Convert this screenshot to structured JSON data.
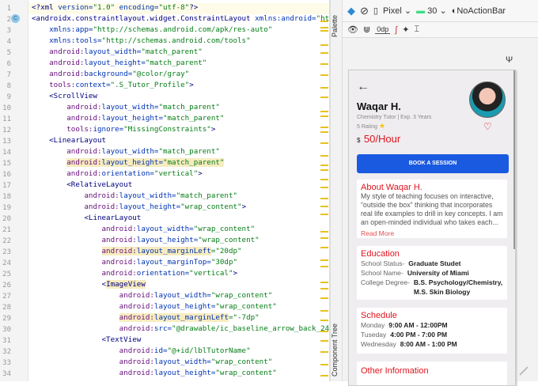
{
  "editor": {
    "lines": [
      {
        "i": 0,
        "t": [
          [
            "tag",
            "<?xml "
          ],
          [
            "attr",
            "version="
          ],
          [
            "val",
            "\"1.0\" "
          ],
          [
            "attr",
            "encoding="
          ],
          [
            "val",
            "\"utf-8\""
          ],
          [
            "tag",
            "?>"
          ]
        ],
        "cur": true
      },
      {
        "i": 0,
        "t": [
          [
            "tag",
            "<androidx.constraintlayout.widget.ConstraintLayout "
          ],
          [
            "attr",
            "xmlns:android="
          ],
          [
            "val",
            "\"ht"
          ]
        ]
      },
      {
        "i": 1,
        "t": [
          [
            "attr",
            "xmlns:app="
          ],
          [
            "val",
            "\"http://schemas.android.com/apk/res-auto\""
          ]
        ]
      },
      {
        "i": 1,
        "t": [
          [
            "attr",
            "xmlns:tools="
          ],
          [
            "val",
            "\"http://schemas.android.com/tools\""
          ]
        ]
      },
      {
        "i": 1,
        "t": [
          [
            "ns",
            "android:"
          ],
          [
            "attr",
            "layout_width="
          ],
          [
            "val",
            "\"match_parent\""
          ]
        ]
      },
      {
        "i": 1,
        "t": [
          [
            "ns",
            "android:"
          ],
          [
            "attr",
            "layout_height="
          ],
          [
            "val",
            "\"match_parent\""
          ]
        ]
      },
      {
        "i": 1,
        "t": [
          [
            "ns",
            "android:"
          ],
          [
            "attr",
            "background="
          ],
          [
            "val",
            "\"@color/gray\""
          ]
        ]
      },
      {
        "i": 1,
        "t": [
          [
            "ns",
            "tools:"
          ],
          [
            "attr",
            "context="
          ],
          [
            "val",
            "\".S_Tutor_Profile\""
          ],
          [
            "tag",
            ">"
          ]
        ]
      },
      {
        "i": 1,
        "t": [
          [
            "tag",
            "<ScrollView"
          ]
        ]
      },
      {
        "i": 2,
        "t": [
          [
            "ns",
            "android:"
          ],
          [
            "attr",
            "layout_width="
          ],
          [
            "val",
            "\"match_parent\""
          ]
        ]
      },
      {
        "i": 2,
        "t": [
          [
            "ns",
            "android:"
          ],
          [
            "attr",
            "layout_height="
          ],
          [
            "val",
            "\"match_parent\""
          ]
        ]
      },
      {
        "i": 2,
        "t": [
          [
            "ns",
            "tools:"
          ],
          [
            "attr",
            "ignore="
          ],
          [
            "val",
            "\"MissingConstraints\""
          ],
          [
            "tag",
            ">"
          ]
        ]
      },
      {
        "i": 1,
        "t": [
          [
            "tag",
            "<LinearLayout"
          ]
        ]
      },
      {
        "i": 2,
        "t": [
          [
            "ns",
            "android:"
          ],
          [
            "attr",
            "layout_width="
          ],
          [
            "val",
            "\"match_parent\""
          ]
        ]
      },
      {
        "i": 2,
        "t": [
          [
            "ns h",
            "android:"
          ],
          [
            "attr h",
            "layout_height="
          ],
          [
            "val h",
            "\"match_parent\""
          ]
        ]
      },
      {
        "i": 2,
        "t": [
          [
            "ns",
            "android:"
          ],
          [
            "attr",
            "orientation="
          ],
          [
            "val",
            "\"vertical\""
          ],
          [
            "tag",
            ">"
          ]
        ]
      },
      {
        "i": 2,
        "t": [
          [
            "tag",
            "<RelativeLayout"
          ]
        ]
      },
      {
        "i": 3,
        "t": [
          [
            "ns",
            "android:"
          ],
          [
            "attr",
            "layout_width="
          ],
          [
            "val",
            "\"match_parent\""
          ]
        ]
      },
      {
        "i": 3,
        "t": [
          [
            "ns",
            "android:"
          ],
          [
            "attr",
            "layout_height="
          ],
          [
            "val",
            "\"wrap_content\""
          ],
          [
            "tag",
            ">"
          ]
        ]
      },
      {
        "i": 3,
        "t": [
          [
            "tag",
            "<LinearLayout"
          ]
        ]
      },
      {
        "i": 4,
        "t": [
          [
            "ns",
            "android:"
          ],
          [
            "attr",
            "layout_width="
          ],
          [
            "val",
            "\"wrap_content\""
          ]
        ]
      },
      {
        "i": 4,
        "t": [
          [
            "ns",
            "android:"
          ],
          [
            "attr",
            "layout_height="
          ],
          [
            "val",
            "\"wrap_content\""
          ]
        ]
      },
      {
        "i": 4,
        "t": [
          [
            "ns h",
            "android:"
          ],
          [
            "attr h",
            "layout_marginLeft"
          ],
          [
            "val",
            "=\"20dp\""
          ]
        ]
      },
      {
        "i": 4,
        "t": [
          [
            "ns",
            "android:"
          ],
          [
            "attr",
            "layout_marginTop="
          ],
          [
            "val",
            "\"30dp\""
          ]
        ]
      },
      {
        "i": 4,
        "t": [
          [
            "ns",
            "android:"
          ],
          [
            "attr",
            "orientation="
          ],
          [
            "val",
            "\"vertical\""
          ],
          [
            "tag",
            ">"
          ]
        ]
      },
      {
        "i": 4,
        "t": [
          [
            "tag",
            "<"
          ],
          [
            "tag h",
            "ImageView"
          ]
        ]
      },
      {
        "i": 5,
        "t": [
          [
            "ns",
            "android:"
          ],
          [
            "attr",
            "layout_width="
          ],
          [
            "val",
            "\"wrap_content\""
          ]
        ]
      },
      {
        "i": 5,
        "t": [
          [
            "ns",
            "android:"
          ],
          [
            "attr",
            "layout_height="
          ],
          [
            "val",
            "\"wrap_content\""
          ]
        ]
      },
      {
        "i": 5,
        "t": [
          [
            "ns h",
            "android:"
          ],
          [
            "attr h",
            "layout_marginLeft"
          ],
          [
            "val",
            "=\"-7dp\""
          ]
        ]
      },
      {
        "i": 5,
        "t": [
          [
            "ns",
            "android:"
          ],
          [
            "attr",
            "src="
          ],
          [
            "val",
            "\"@drawable/ic_baseline_arrow_back_24"
          ]
        ]
      },
      {
        "i": 4,
        "t": [
          [
            "tag",
            "<TextView"
          ]
        ]
      },
      {
        "i": 5,
        "t": [
          [
            "ns",
            "android:"
          ],
          [
            "attr",
            "id="
          ],
          [
            "val",
            "\"@+id/lblTutorName\""
          ]
        ]
      },
      {
        "i": 5,
        "t": [
          [
            "ns",
            "android:"
          ],
          [
            "attr",
            "layout_width="
          ],
          [
            "val",
            "\"wrap_content\""
          ]
        ]
      },
      {
        "i": 5,
        "t": [
          [
            "ns",
            "android:"
          ],
          [
            "attr",
            "layout_height="
          ],
          [
            "val",
            "\"wrap_content\""
          ]
        ]
      }
    ],
    "class_badge": "C"
  },
  "side_tabs": {
    "palette": "Palette",
    "component_tree": "Component Tree"
  },
  "toolbar": {
    "device": "Pixel",
    "api": "30",
    "theme": "NoActionBar",
    "margin": "0dp"
  },
  "profile": {
    "name": "Waqar H.",
    "subtitle": "Chemistry Tutor | Exp. 3 Years",
    "rating": "5 Rating",
    "currency": "$",
    "price": "50/Hour",
    "book_button": "BOOK A SESSION",
    "about_title": "About Waqar H.",
    "about_text": "My style of teaching focuses on interactive, “outside the box” thinking that incorporates real life examples to drill in key concepts. I am an open-minded individual who takes each...",
    "read_more": "Read More",
    "education_title": "Education",
    "education": [
      {
        "label": "School Status-",
        "value": "Graduate Studet"
      },
      {
        "label": "School Name-",
        "value": "University of Miami"
      },
      {
        "label": "College Degree-",
        "value": "B.S. Psychology/Chemistry, M.S. Skin Biology"
      }
    ],
    "schedule_title": "Schedule",
    "schedule": [
      {
        "day": "Monday",
        "time": "9:00 AM - 12:00PM"
      },
      {
        "day": "Tuseday",
        "time": "4:00 PM - 7:00 PM"
      },
      {
        "day": "Wednesday",
        "time": "8:00 AM - 1:00 PM"
      }
    ],
    "other_title": "Other Information"
  },
  "colors": {
    "accent": "#e0141e",
    "button": "#1a5ae0"
  }
}
